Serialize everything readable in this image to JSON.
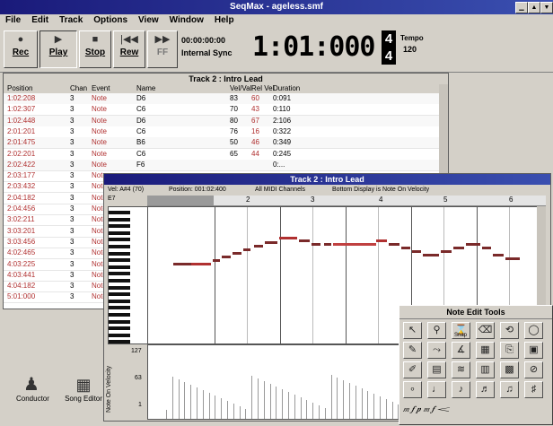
{
  "app": {
    "title": "SeqMax - ageless.smf"
  },
  "menu": [
    "File",
    "Edit",
    "Track",
    "Options",
    "View",
    "Window",
    "Help"
  ],
  "transport": {
    "rec": "Rec",
    "play": "Play",
    "stop": "Stop",
    "rew": "Rew",
    "ff": "FF",
    "time": "00:00:00:00",
    "sync": "Internal Sync",
    "counter": "1:01:000",
    "ts_top": "4",
    "ts_bottom": "4",
    "tempo_label": "Tempo",
    "tempo_value": "120"
  },
  "event_list": {
    "title": "Track 2 : Intro Lead",
    "headers": [
      "Position",
      "Chan",
      "Event",
      "Name",
      "Vel/Val",
      "Rel Vel",
      "Duration"
    ],
    "rows": [
      [
        "1:02:208",
        "3",
        "Note",
        "D6",
        "83",
        "60",
        "0:091"
      ],
      [
        "1:02:307",
        "3",
        "Note",
        "C6",
        "70",
        "43",
        "0:110"
      ],
      [
        "1:02:448",
        "3",
        "Note",
        "D6",
        "80",
        "67",
        "2:106"
      ],
      [
        "2:01:201",
        "3",
        "Note",
        "C6",
        "76",
        "16",
        "0:322"
      ],
      [
        "2:01:475",
        "3",
        "Note",
        "B6",
        "50",
        "46",
        "0:349"
      ],
      [
        "2:02:201",
        "3",
        "Note",
        "C6",
        "65",
        "44",
        "0:245"
      ],
      [
        "2:02:422",
        "3",
        "Note",
        "F6",
        "",
        "",
        "0:..."
      ],
      [
        "2:03:177",
        "3",
        "Note",
        "",
        "",
        "",
        ""
      ],
      [
        "2:03:432",
        "3",
        "Note",
        "",
        "",
        "",
        ""
      ],
      [
        "2:04:182",
        "3",
        "Note",
        "",
        "",
        "",
        ""
      ],
      [
        "2:04:456",
        "3",
        "Note",
        "",
        "",
        "",
        ""
      ],
      [
        "3:02:211",
        "3",
        "Note",
        "",
        "",
        "",
        ""
      ],
      [
        "3:03:201",
        "3",
        "Note",
        "",
        "",
        "",
        ""
      ],
      [
        "3:03:456",
        "3",
        "Note",
        "",
        "",
        "",
        ""
      ],
      [
        "4:02:465",
        "3",
        "Note",
        "",
        "",
        "",
        ""
      ],
      [
        "4:03:225",
        "3",
        "Note",
        "",
        "",
        "",
        ""
      ],
      [
        "4:03:441",
        "3",
        "Note",
        "",
        "",
        "",
        ""
      ],
      [
        "4:04:182",
        "3",
        "Note",
        "",
        "",
        "",
        ""
      ],
      [
        "5:01:000",
        "3",
        "Note",
        "",
        "",
        "",
        ""
      ]
    ]
  },
  "piano_roll": {
    "title": "Track 2 : Intro Lead",
    "info_vel": "Vel: A#4 (70)",
    "info_pos": "Position: 001:02:400",
    "info_chan": "All MIDI Channels",
    "info_bottom": "Bottom Display is Note On Velocity",
    "low_note": "E7",
    "bars": [
      "2",
      "3",
      "4",
      "5",
      "6"
    ],
    "vel_label": "Note On Velocity",
    "vel_ticks": [
      "127",
      "63",
      "1"
    ]
  },
  "note_tools": {
    "title": "Note Edit Tools",
    "snap": "Snap"
  },
  "desktop": {
    "conductor": "Conductor",
    "song_editor": "Song Editor"
  }
}
